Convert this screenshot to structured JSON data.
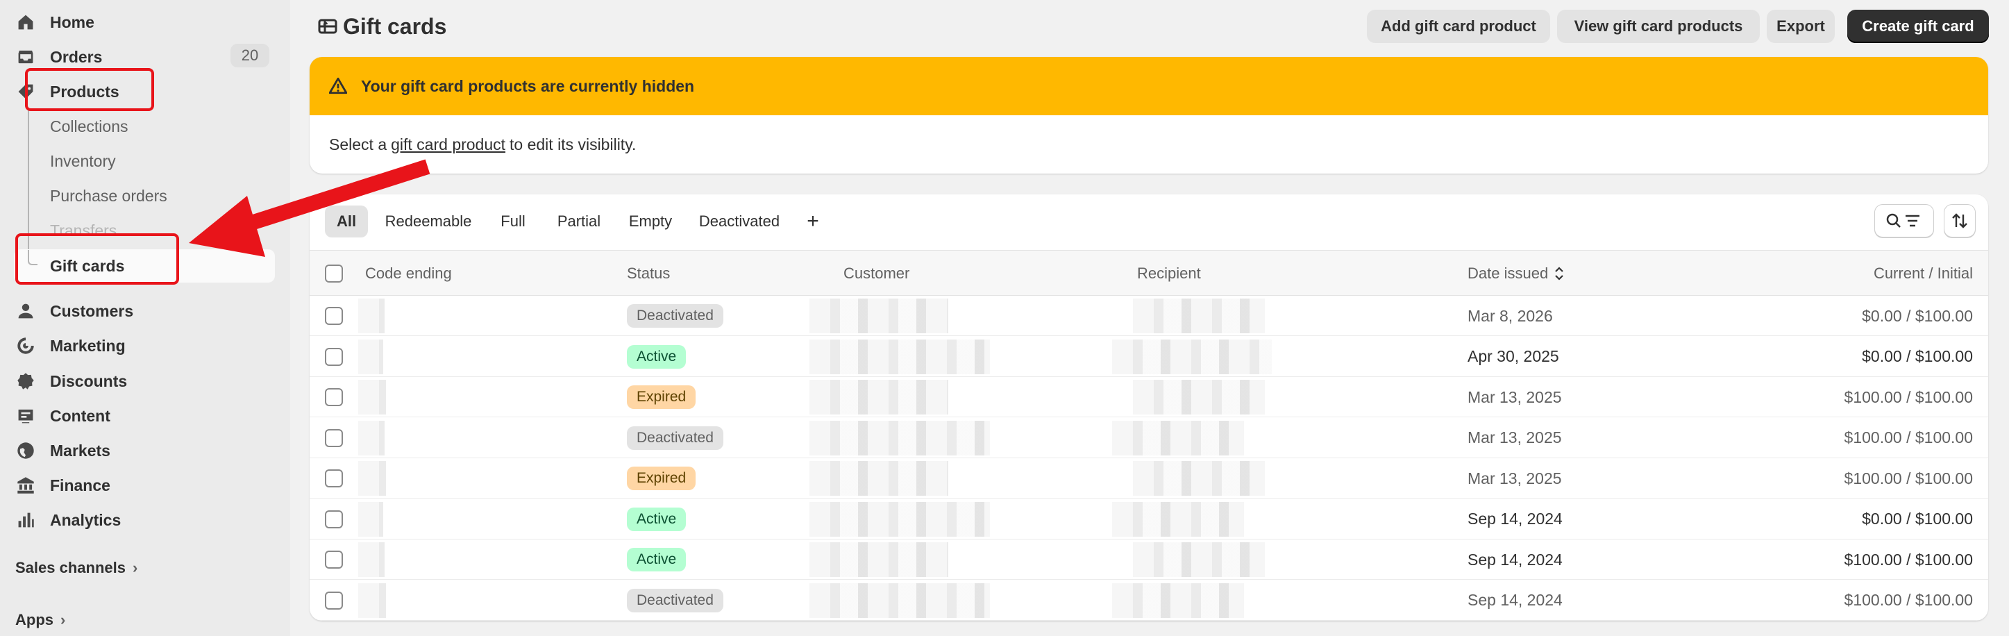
{
  "colors": {
    "accent": "#303030",
    "banner": "#ffb800",
    "annotation_red": "#e8141a",
    "badge_deactivated_bg": "#e3e3e3",
    "badge_active_bg": "#b4fed2",
    "badge_active_fg": "#0c5132",
    "badge_expired_bg": "#ffd6a4",
    "badge_expired_fg": "#5e4200"
  },
  "sidebar": {
    "items": [
      {
        "label": "Home",
        "icon": "home-icon"
      },
      {
        "label": "Orders",
        "icon": "inbox-icon",
        "count": "20"
      },
      {
        "label": "Products",
        "icon": "tag-icon"
      }
    ],
    "product_subitems": [
      "Collections",
      "Inventory",
      "Purchase orders",
      "Transfers",
      "Gift cards"
    ],
    "items_after": [
      {
        "label": "Customers",
        "icon": "person-icon"
      },
      {
        "label": "Marketing",
        "icon": "target-icon"
      },
      {
        "label": "Discounts",
        "icon": "discount-icon"
      },
      {
        "label": "Content",
        "icon": "content-icon"
      },
      {
        "label": "Markets",
        "icon": "globe-icon"
      },
      {
        "label": "Finance",
        "icon": "bank-icon"
      },
      {
        "label": "Analytics",
        "icon": "bar-chart-icon"
      }
    ],
    "sales_channels": "Sales channels",
    "apps": "Apps"
  },
  "header": {
    "title": "Gift cards",
    "buttons": {
      "add": "Add gift card product",
      "view": "View gift card products",
      "export": "Export",
      "create": "Create gift card"
    }
  },
  "banner": {
    "title": "Your gift card products are currently hidden",
    "body_before": "Select a",
    "body_link": "gift card product",
    "body_after": "to edit its visibility."
  },
  "tabs": [
    "All",
    "Redeemable",
    "Full",
    "Partial",
    "Empty",
    "Deactivated"
  ],
  "add_tab": "+",
  "table": {
    "columns": {
      "code": "Code ending",
      "status": "Status",
      "customer": "Customer",
      "recipient": "Recipient",
      "date": "Date issued",
      "balance": "Current / Initial"
    },
    "rows": [
      {
        "status": "Deactivated",
        "date": "Mar 8, 2026",
        "balance": "$0.00 / $100.00"
      },
      {
        "status": "Active",
        "date": "Apr 30, 2025",
        "balance": "$0.00 / $100.00"
      },
      {
        "status": "Expired",
        "date": "Mar 13, 2025",
        "balance": "$100.00 / $100.00"
      },
      {
        "status": "Deactivated",
        "date": "Mar 13, 2025",
        "balance": "$100.00 / $100.00"
      },
      {
        "status": "Expired",
        "date": "Mar 13, 2025",
        "balance": "$100.00 / $100.00"
      },
      {
        "status": "Active",
        "date": "Sep 14, 2024",
        "balance": "$0.00 / $100.00"
      },
      {
        "status": "Active",
        "date": "Sep 14, 2024",
        "balance": "$100.00 / $100.00"
      },
      {
        "status": "Deactivated",
        "date": "Sep 14, 2024",
        "balance": "$100.00 / $100.00"
      }
    ]
  }
}
